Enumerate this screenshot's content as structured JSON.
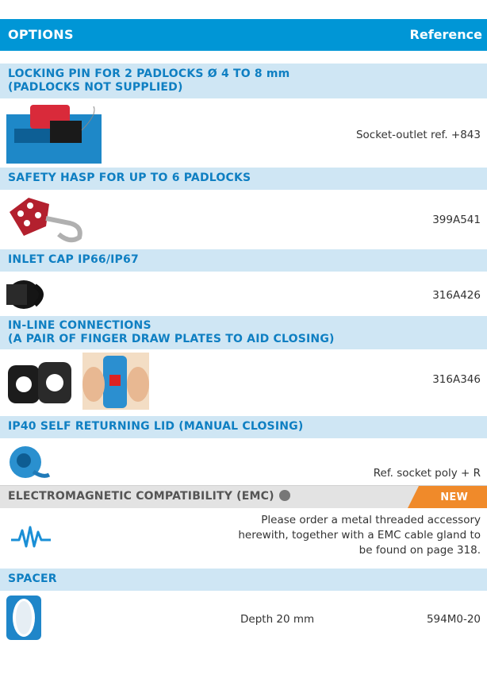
{
  "header": {
    "title": "OPTIONS",
    "ref_label": "Reference"
  },
  "sections": [
    {
      "title_lines": [
        "LOCKING PIN FOR 2 PADLOCKS Ø 4 TO 8 mm",
        "(PADLOCKS NOT SUPPLIED)"
      ],
      "ref": "Socket-outlet ref. +843"
    },
    {
      "title": "SAFETY HASP FOR UP TO 6 PADLOCKS",
      "ref": "399A541"
    },
    {
      "title": "INLET CAP IP66/IP67",
      "ref": "316A426"
    },
    {
      "title_lines": [
        "IN-LINE CONNECTIONS",
        "(A PAIR OF FINGER DRAW PLATES TO AID CLOSING)"
      ],
      "ref": "316A346"
    },
    {
      "title": "IP40 SELF RETURNING LID (MANUAL CLOSING)",
      "ref": "Ref. socket poly + R"
    },
    {
      "title": "ELECTROMAGNETIC COMPATIBILITY (EMC)",
      "badge": "NEW",
      "desc_lines": [
        "Please order a metal threaded accessory",
        "herewith, together with a EMC cable gland to",
        "be found on page 318."
      ]
    },
    {
      "title": "SPACER",
      "desc": "Depth 20 mm",
      "ref": "594M0-20"
    }
  ],
  "colors": {
    "header_bg": "#0096d6",
    "band_bg": "#cfe6f4",
    "band_text": "#0f7fc2",
    "emc_band_bg": "#e3e3e3",
    "new_badge": "#f08a2a"
  }
}
